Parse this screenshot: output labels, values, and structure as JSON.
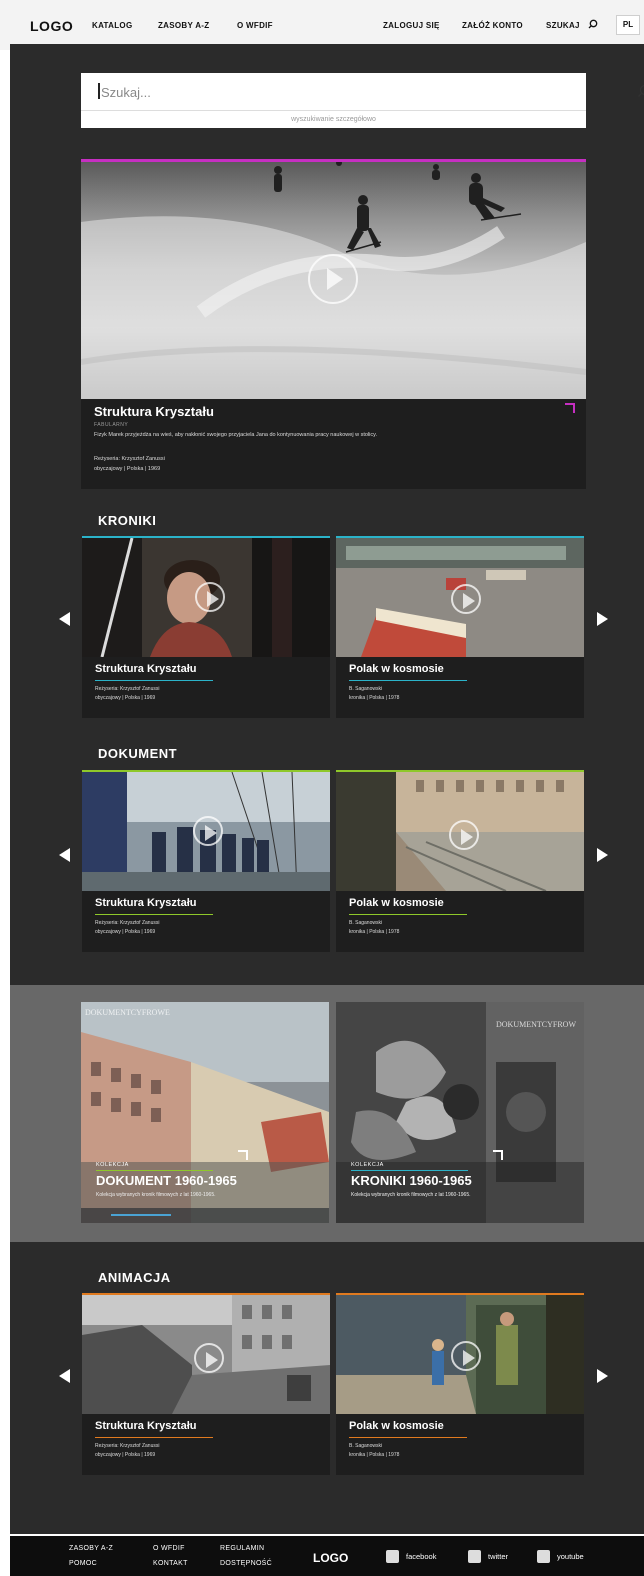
{
  "nav": {
    "logo": "LOGO",
    "links": [
      "KATALOG",
      "ZASOBY A-Z",
      "O WFDIF"
    ],
    "login": "ZALOGUJ SIĘ",
    "register": "ZAŁÓŻ KONTO",
    "search": "SZUKAJ",
    "lang": "PL"
  },
  "search": {
    "placeholder": "Szukaj...",
    "advanced": "wyszukiwanie szczegółowo"
  },
  "hero": {
    "title": "Struktura Kryształu",
    "genre": "FABULARNY",
    "description": "Fizyk Marek przyjeżdża na wieś, aby nakłonić swojego przyjaciela Jana do kontynuowania pracy naukowej w stolicy.",
    "director": "Reżyseria: Krzysztof Zanussi",
    "meta": "obyczajowy | Polska | 1969",
    "accent": "#c62fc2"
  },
  "sections": [
    {
      "title": "KRONIKI",
      "accent": "#2bb3c9",
      "cards": [
        {
          "title": "Struktura Kryształu",
          "line1": "Reżyseria: Krzysztof Zanussi",
          "line2": "obyczajowy | Polska | 1969"
        },
        {
          "title": "Polak w kosmosie",
          "line1": "B. Saganowski",
          "line2": "kronika | Polska | 1978"
        }
      ]
    },
    {
      "title": "DOKUMENT",
      "accent": "#8fc82a",
      "cards": [
        {
          "title": "Struktura Kryształu",
          "line1": "Reżyseria: Krzysztof Zanussi",
          "line2": "obyczajowy | Polska | 1969"
        },
        {
          "title": "Polak w kosmosie",
          "line1": "B. Saganowski",
          "line2": "kronika | Polska | 1978"
        }
      ]
    },
    {
      "title": "ANIMACJA",
      "accent": "#e07a1f",
      "cards": [
        {
          "title": "Struktura Kryształu",
          "line1": "Reżyseria: Krzysztof Zanussi",
          "line2": "obyczajowy | Polska | 1969"
        },
        {
          "title": "Polak w kosmosie",
          "line1": "B. Saganowski",
          "line2": "kronika | Polska | 1978"
        }
      ]
    }
  ],
  "collections": [
    {
      "label": "KOLEKCJA",
      "title": "DOKUMENT 1960-1965",
      "desc": "Kolekcja wybranych kronik filmowych z lat 1960-1965.",
      "watermark": "DOKUMENTCYFROWE",
      "accent": "#8fc82a"
    },
    {
      "label": "KOLEKCJA",
      "title": "KRONIKI 1960-1965",
      "desc": "Kolekcja wybranych kronik filmowych z lat 1960-1965.",
      "watermark": "DOKUMENTCYFROW",
      "accent": "#2bb3c9"
    }
  ],
  "footer": {
    "col1": [
      "ZASOBY A-Z",
      "POMOC"
    ],
    "col2": [
      "O WFDIF",
      "KONTAKT"
    ],
    "col3": [
      "REGULAMIN",
      "DOSTĘPNOŚĆ"
    ],
    "logo": "LOGO",
    "social": [
      "facebook",
      "twitter",
      "youtube"
    ]
  }
}
